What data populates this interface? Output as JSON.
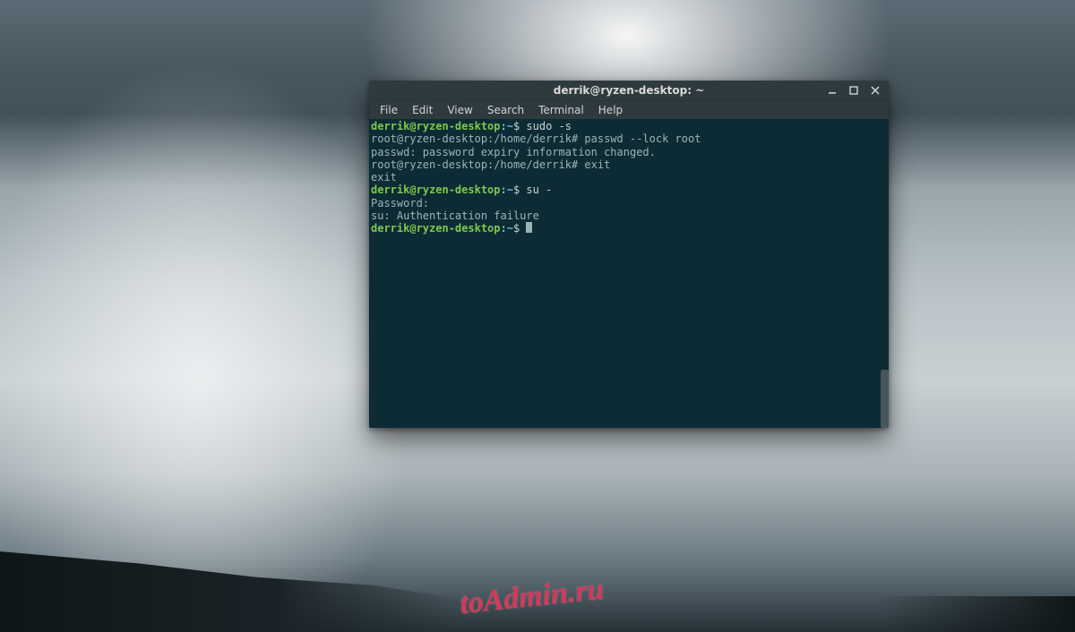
{
  "window": {
    "title": "derrik@ryzen-desktop: ~"
  },
  "menu": {
    "file": "File",
    "edit": "Edit",
    "view": "View",
    "search": "Search",
    "terminal": "Terminal",
    "help": "Help"
  },
  "prompt": {
    "user_host": "derrik@ryzen-desktop",
    "sep": ":",
    "path": "~",
    "dollar": "$"
  },
  "lines": {
    "cmd1": " sudo -s",
    "root1": "root@ryzen-desktop:/home/derrik# passwd --lock root",
    "out1": "passwd: password expiry information changed.",
    "root2": "root@ryzen-desktop:/home/derrik# exit",
    "out2": "exit",
    "cmd2": " su -",
    "pw": "Password:",
    "fail": "su: Authentication failure"
  },
  "watermark": "toAdmin.ru"
}
